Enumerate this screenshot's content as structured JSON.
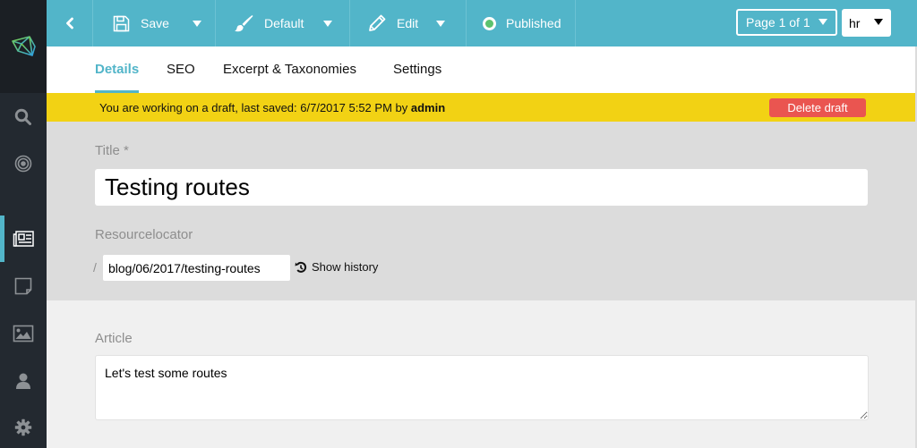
{
  "toolbar": {
    "back_icon": "chevron-left-icon",
    "save": {
      "label": "Save",
      "icon": "floppy-disk-icon"
    },
    "template": {
      "label": "Default",
      "icon": "paintbrush-icon"
    },
    "mode": {
      "label": "Edit",
      "icon": "pencil-icon"
    },
    "status": {
      "label": "Published",
      "color": "#5cc26e"
    },
    "page_select": "Page 1 of 1",
    "language": "hr"
  },
  "sidebar": {
    "items": [
      {
        "name": "search",
        "icon": "search-icon"
      },
      {
        "name": "target",
        "icon": "target-icon"
      },
      {
        "name": "articles",
        "icon": "newspaper-icon",
        "active": true
      },
      {
        "name": "snippets",
        "icon": "sticky-note-icon"
      },
      {
        "name": "media",
        "icon": "image-icon"
      },
      {
        "name": "contacts",
        "icon": "user-icon"
      },
      {
        "name": "settings",
        "icon": "gear-icon"
      }
    ]
  },
  "tabs": [
    {
      "label": "Details",
      "active": true
    },
    {
      "label": "SEO"
    },
    {
      "label": "Excerpt & Taxonomies"
    },
    {
      "label": "Settings"
    }
  ],
  "banner": {
    "text": "You are working on a draft, last saved: 6/7/2017 5:52 PM by ",
    "user": "admin",
    "delete_label": "Delete draft"
  },
  "form": {
    "title_label": "Title *",
    "title_value": "Testing routes",
    "resource_label": "Resourcelocator",
    "resource_prefix": "/",
    "resource_value": "blog/06/2017/testing-routes",
    "history_label": "Show history",
    "article_label": "Article",
    "article_value": "Let's test some routes"
  },
  "colors": {
    "accent": "#52b5c9",
    "banner": "#f2d214",
    "danger": "#ea5550",
    "sidebar": "#232930"
  }
}
